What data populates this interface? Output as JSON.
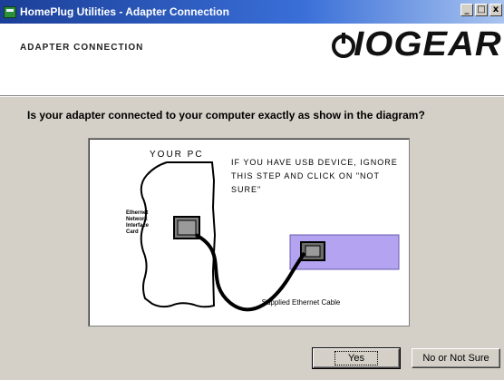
{
  "window": {
    "title": "HomePlug Utilities - Adapter Connection",
    "controls": {
      "minimize": "_",
      "maximize": "□",
      "close": "x"
    }
  },
  "header": {
    "section_label": "ADAPTER CONNECTION",
    "logo_text": "IOGEAR"
  },
  "question": "Is your adapter connected to your computer exactly as show in the diagram?",
  "diagram": {
    "pc_label": "YOUR PC",
    "usb_note": "IF YOU HAVE USB DEVICE, IGNORE THIS STEP AND CLICK ON \"NOT SURE\"",
    "card_label": "Ethernet Network Interface Card",
    "cable_label": "Supplied Ethernet Cable",
    "colors": {
      "adapter": "#b3a3f0",
      "card": "#808080"
    }
  },
  "buttons": {
    "yes": "Yes",
    "no_or_not_sure": "No or Not Sure"
  }
}
